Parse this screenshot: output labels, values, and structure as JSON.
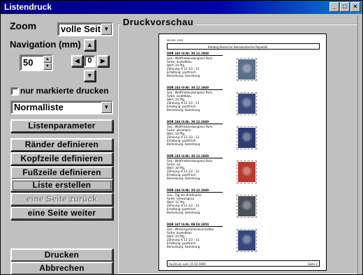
{
  "window": {
    "title": "Listendruck"
  },
  "title_buttons": [
    "_",
    "□",
    "×"
  ],
  "left": {
    "zoom_label": "Zoom",
    "zoom_value": "volle Seite",
    "nav_label": "Navigation (mm)",
    "nav_value": "50",
    "nav_center": "0",
    "only_marked_label": "nur markierte drucken",
    "only_marked_checked": false,
    "list_type_value": "Normalliste",
    "buttons": {
      "list_params": "Listenparameter",
      "margins": "Ränder definieren",
      "header": "Kopfzeile definieren",
      "footer": "Fußzeile definieren",
      "create_list": "Liste erstellen",
      "prev_page": "eine Seite zurück",
      "next_page": "eine Seite weiter",
      "print": "Drucken",
      "cancel": "Abbrechen"
    }
  },
  "preview": {
    "group_title": "Druckvorschau",
    "page": {
      "header_left": "MICHEL 1995",
      "header_title": "Katalog Deutsche Demokratische Republik",
      "footer_left": "Ausdruck vom 15.02.1995",
      "footer_right": "Seite 1",
      "entries": [
        {
          "head": "DDR 242 Ur.Nr. 30.12.1949",
          "lines": [
            "Gez.: Weltfriedenskongress Paris",
            "Farbe: dunkelblau",
            "Wert: 24 Pfg.",
            "Zähnung: K 13 1/2 : 13",
            "Erhaltung: postfrisch",
            "Bemerkung: Sammlung"
          ],
          "stamp_color": "#5a6f8c"
        },
        {
          "head": "DDR 243 Ur.Nr. 30.12.1949",
          "lines": [
            "Gez.: Weltfriedenskongress Paris",
            "Farbe: violettblau",
            "Wert: 24 Pfg.",
            "Zähnung: K 13 1/2 : 13",
            "Erhaltung: postfrisch",
            "Bemerkung: Sammlung"
          ],
          "stamp_color": "#3b4a7a"
        },
        {
          "head": "DDR 244 Ur.Nr. 30.12.1949",
          "lines": [
            "Gez.: Weltfriedenskongress Paris",
            "Farbe: ultramarin",
            "Wert: 50 Pfg.",
            "Zähnung: K 13 1/2 : 13",
            "Erhaltung: postfrisch",
            "Bemerkung: Sammlung"
          ],
          "stamp_color": "#2f3d72"
        },
        {
          "head": "DDR 245 Ur.Nr. 30.12.1949",
          "lines": [
            "Gez.: Weltfriedenskongress Paris",
            "Farbe: rot",
            "Wert: 30 Pfg.",
            "Zähnung: K 13 1/2 : 13",
            "Erhaltung: postfrisch",
            "Bemerkung: Sammlung"
          ],
          "stamp_color": "#b83a2e"
        },
        {
          "head": "DDR 246 Ur.Nr. 20.12.1949",
          "lines": [
            "Gez.: Tag der Briefmarke",
            "Farbe: schwarzgrau",
            "Wert: 12 Pfg.",
            "Zähnung: K 13 1/2 : 13",
            "Erhaltung: postfrisch",
            "Bemerkung: Sammlung"
          ],
          "stamp_color": "#4a4f5a"
        },
        {
          "head": "DDR 247 Ur.Nr. 09.03.1950",
          "lines": [
            "Gez.: Wintersportmeisterschaften",
            "Farbe: dunkelblau",
            "Wert: 24 Pfg.",
            "Zähnung: K 13 1/2 : 13",
            "Erhaltung: postfrisch",
            "Bemerkung: Sammlung"
          ],
          "stamp_color": "#34487e"
        }
      ]
    }
  },
  "colors": {
    "title_bar": "#000080",
    "face": "#c0c0c0"
  }
}
